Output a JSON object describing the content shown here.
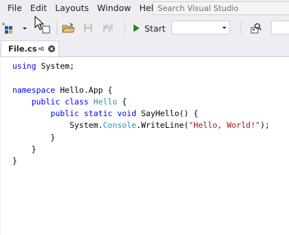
{
  "menu": {
    "items": [
      "File",
      "Edit",
      "Layouts",
      "Window",
      "Help"
    ]
  },
  "search": {
    "placeholder": "Search Visual Studio"
  },
  "toolbar": {
    "start_label": "Start",
    "config_value": "",
    "icons": [
      "new-project-icon",
      "new-item-icon",
      "open-folder-icon",
      "save-icon",
      "save-all-icon",
      "play-icon",
      "find-icon"
    ]
  },
  "tabs": [
    {
      "label": "File.cs",
      "active": true
    }
  ],
  "editor": {
    "lines": [
      [
        {
          "t": "using",
          "c": "kw"
        },
        {
          "t": " System;",
          "c": ""
        }
      ],
      [],
      [
        {
          "t": "namespace",
          "c": "kw"
        },
        {
          "t": " Hello.App {",
          "c": ""
        }
      ],
      [
        {
          "t": "    ",
          "c": ""
        },
        {
          "t": "public",
          "c": "kw"
        },
        {
          "t": " ",
          "c": ""
        },
        {
          "t": "class",
          "c": "kw"
        },
        {
          "t": " ",
          "c": ""
        },
        {
          "t": "Hello",
          "c": "ty"
        },
        {
          "t": " {",
          "c": ""
        }
      ],
      [
        {
          "t": "        ",
          "c": ""
        },
        {
          "t": "public",
          "c": "kw"
        },
        {
          "t": " ",
          "c": ""
        },
        {
          "t": "static",
          "c": "kw"
        },
        {
          "t": " ",
          "c": ""
        },
        {
          "t": "void",
          "c": "kw"
        },
        {
          "t": " SayHello() {",
          "c": ""
        }
      ],
      [
        {
          "t": "            System.",
          "c": ""
        },
        {
          "t": "Console",
          "c": "ty"
        },
        {
          "t": ".WriteLine(",
          "c": ""
        },
        {
          "t": "\"Hello, World!\"",
          "c": "st"
        },
        {
          "t": ");",
          "c": ""
        }
      ],
      [
        {
          "t": "        }",
          "c": ""
        }
      ],
      [
        {
          "t": "    }",
          "c": ""
        }
      ],
      [
        {
          "t": "}",
          "c": ""
        }
      ]
    ]
  },
  "colors": {
    "keyword": "#0000ff",
    "type": "#2b91af",
    "string": "#a31515",
    "play": "#1f8a1f",
    "chrome": "#eeeef2"
  }
}
